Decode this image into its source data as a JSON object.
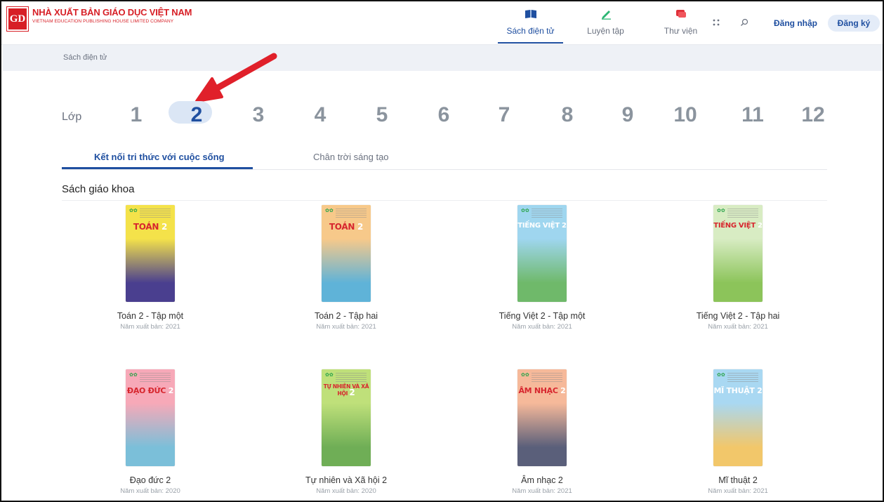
{
  "brand": {
    "mark": "GD",
    "title": "NHÀ XUẤT BẢN GIÁO DỤC VIỆT NAM",
    "subtitle": "VIETNAM EDUCATION PUBLISHING HOUSE LIMITED COMPANY"
  },
  "nav": [
    {
      "label": "Sách điện tử",
      "icon": "book-icon",
      "active": true
    },
    {
      "label": "Luyện tập",
      "icon": "pencil-icon",
      "active": false
    },
    {
      "label": "Thư viện",
      "icon": "chat-icon",
      "active": false
    }
  ],
  "auth": {
    "login": "Đăng nhập",
    "signup": "Đăng ký"
  },
  "breadcrumb": "Sách điện tử",
  "grades": {
    "label": "Lớp",
    "items": [
      "1",
      "2",
      "3",
      "4",
      "5",
      "6",
      "7",
      "8",
      "9",
      "10",
      "11",
      "12"
    ],
    "selected": "2"
  },
  "series": [
    {
      "label": "Kết nối tri thức với cuộc sống",
      "active": true
    },
    {
      "label": "Chân trời sáng tạo",
      "active": false
    }
  ],
  "section_title": "Sách giáo khoa",
  "books": [
    {
      "name": "Toán 2 - Tập một",
      "year": "Năm xuất bản: 2021",
      "cover_title": "TOÁN",
      "cover_num": "2",
      "band": "#f4e24a",
      "scene": "#4a3f8f"
    },
    {
      "name": "Toán 2 - Tập hai",
      "year": "Năm xuất bản: 2021",
      "cover_title": "TOÁN",
      "cover_num": "2",
      "band": "#f7c98a",
      "scene": "#5fb3d8"
    },
    {
      "name": "Tiếng Việt 2 - Tập một",
      "year": "Năm xuất bản: 2021",
      "cover_title": "TIẾNG VIỆT",
      "cover_num": "2",
      "band": "#9fd6ef",
      "scene": "#6fb96a"
    },
    {
      "name": "Tiếng Việt 2 - Tập hai",
      "year": "Năm xuất bản: 2021",
      "cover_title": "TIẾNG VIỆT",
      "cover_num": "2",
      "band": "#d8ecc3",
      "scene": "#8cc45a"
    },
    {
      "name": "Đạo đức 2",
      "year": "Năm xuất bản: 2020",
      "cover_title": "ĐẠO ĐỨC",
      "cover_num": "2",
      "band": "#f7a9b8",
      "scene": "#7bbfd9"
    },
    {
      "name": "Tự nhiên và Xã hội 2",
      "year": "Năm xuất bản: 2020",
      "cover_title": "TỰ NHIÊN VÀ XÃ HỘI",
      "cover_num": "2",
      "band": "#bfe07a",
      "scene": "#6fae56"
    },
    {
      "name": "Âm nhạc 2",
      "year": "Năm xuất bản: 2021",
      "cover_title": "ÂM NHẠC",
      "cover_num": "2",
      "band": "#f6b99a",
      "scene": "#5a5f7a"
    },
    {
      "name": "Mĩ thuật 2",
      "year": "Năm xuất bản: 2021",
      "cover_title": "MĨ THUẬT",
      "cover_num": "2",
      "band": "#a9d8f2",
      "scene": "#f2c76a"
    }
  ],
  "colors": {
    "accent": "#1f4fa0",
    "brand_red": "#d71f26",
    "arrow": "#e0202a"
  }
}
